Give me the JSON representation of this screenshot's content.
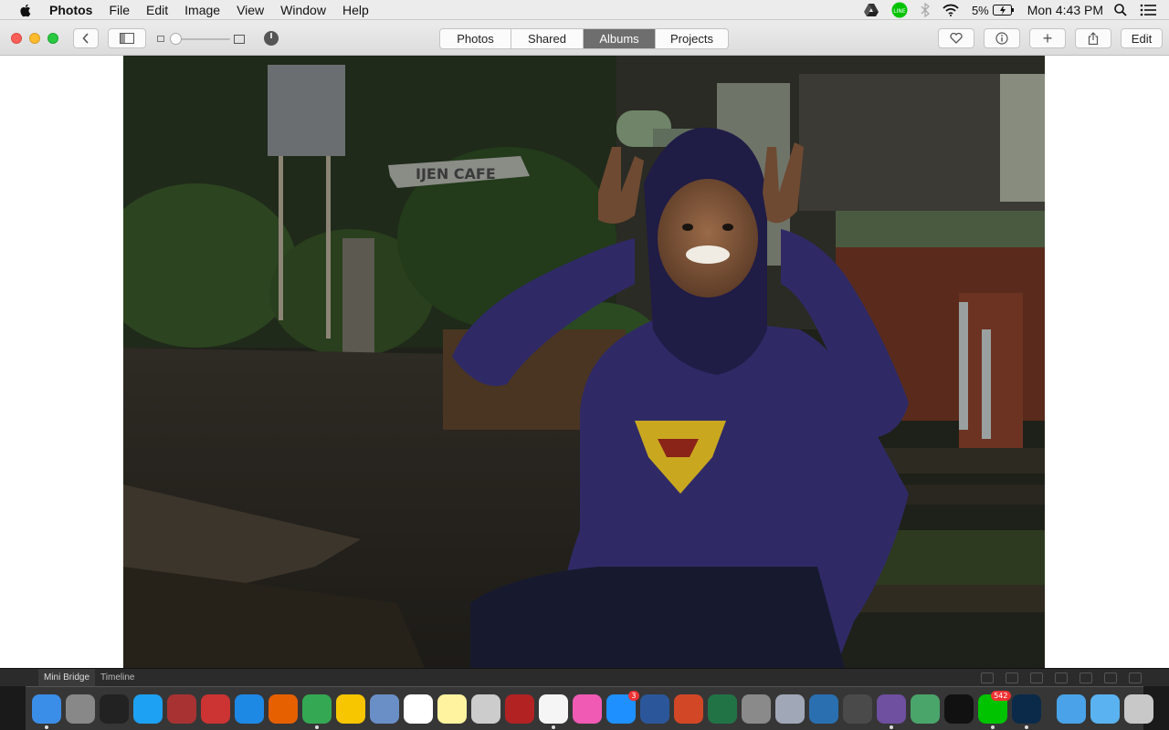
{
  "menubar": {
    "app_name": "Photos",
    "menus": [
      "File",
      "Edit",
      "Image",
      "View",
      "Window",
      "Help"
    ],
    "battery": "5%",
    "clock": "Mon 4:43 PM"
  },
  "toolbar": {
    "tabs": [
      {
        "label": "Photos",
        "active": false
      },
      {
        "label": "Shared",
        "active": false
      },
      {
        "label": "Albums",
        "active": true
      },
      {
        "label": "Projects",
        "active": false
      }
    ],
    "edit_label": "Edit",
    "add_label": "+"
  },
  "photo": {
    "sign_text": "IJEN CAFE"
  },
  "minibridge": {
    "tabs": [
      "Mini Bridge",
      "Timeline"
    ]
  },
  "dock": {
    "items": [
      {
        "name": "finder-icon",
        "color": "#3b8ee8",
        "running": true
      },
      {
        "name": "launchpad-icon",
        "color": "#888888",
        "running": false
      },
      {
        "name": "dashboard-icon",
        "color": "#222222",
        "running": false
      },
      {
        "name": "twitter-icon",
        "color": "#1da1f2",
        "running": false
      },
      {
        "name": "fire-extinguisher-icon",
        "color": "#a83232",
        "running": false
      },
      {
        "name": "scrobbler-icon",
        "color": "#cc3333",
        "running": false
      },
      {
        "name": "safari-icon",
        "color": "#1e88e5",
        "running": false
      },
      {
        "name": "firefox-icon",
        "color": "#e66000",
        "running": false
      },
      {
        "name": "chrome-icon",
        "color": "#34a853",
        "running": true
      },
      {
        "name": "tips-icon",
        "color": "#f7c600",
        "running": false
      },
      {
        "name": "preview-icon",
        "color": "#6a8fc7",
        "running": false
      },
      {
        "name": "calendar-icon",
        "color": "#ffffff",
        "running": false
      },
      {
        "name": "notes-icon",
        "color": "#fff3a0",
        "running": false
      },
      {
        "name": "image-capture-icon",
        "color": "#cccccc",
        "running": false
      },
      {
        "name": "photo-booth-icon",
        "color": "#b22222",
        "running": false
      },
      {
        "name": "photos-icon",
        "color": "#f5f5f5",
        "running": true
      },
      {
        "name": "itunes-icon",
        "color": "#f05ab4",
        "running": false
      },
      {
        "name": "app-store-icon",
        "color": "#1e90ff",
        "running": false,
        "badge": "3"
      },
      {
        "name": "word-icon",
        "color": "#2b579a",
        "running": false
      },
      {
        "name": "powerpoint-icon",
        "color": "#d24726",
        "running": false
      },
      {
        "name": "excel-icon",
        "color": "#217346",
        "running": false
      },
      {
        "name": "system-preferences-icon",
        "color": "#8a8a8a",
        "running": false
      },
      {
        "name": "settings-gear-icon",
        "color": "#a0a8b8",
        "running": false
      },
      {
        "name": "evernote-elephant-icon",
        "color": "#2a6fb0",
        "running": false
      },
      {
        "name": "sublime-text-icon",
        "color": "#4a4a4a",
        "running": false
      },
      {
        "name": "github-icon",
        "color": "#6e4fa0",
        "running": true
      },
      {
        "name": "atom-icon",
        "color": "#4aa56a",
        "running": false
      },
      {
        "name": "terminal-icon",
        "color": "#111111",
        "running": false
      },
      {
        "name": "line-icon",
        "color": "#00c300",
        "running": true,
        "badge": "542"
      },
      {
        "name": "photoshop-icon",
        "color": "#0b2a4a",
        "running": true
      },
      {
        "name": "folder-icon",
        "color": "#4aa3e8",
        "running": false
      },
      {
        "name": "downloads-folder-icon",
        "color": "#5ab3f0",
        "running": false
      },
      {
        "name": "trash-icon",
        "color": "#c8c8c8",
        "running": false
      }
    ]
  }
}
